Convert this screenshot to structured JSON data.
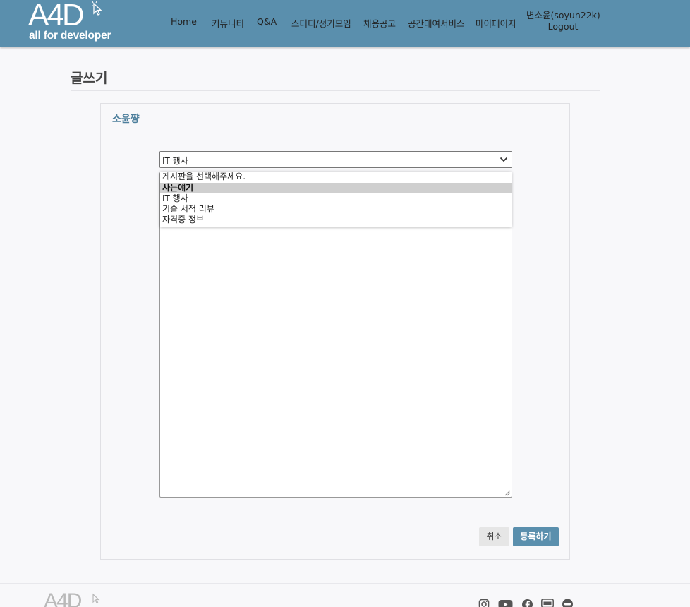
{
  "header": {
    "logo_main": "A4D",
    "logo_sub": "all for developer",
    "nav": [
      {
        "label": "Home"
      },
      {
        "label": "커뮤니티"
      },
      {
        "label": "Q&A"
      },
      {
        "label": "스터디/정기모임"
      },
      {
        "label": "채용공고"
      },
      {
        "label": "공간대여서비스"
      },
      {
        "label": "마이페이지"
      }
    ],
    "user_name": "변소윤(soyun22k)",
    "logout_label": "Logout"
  },
  "page": {
    "title": "글쓰기"
  },
  "card": {
    "title": "소윤쨩",
    "select_value": "IT 행사",
    "dropdown_options": [
      {
        "label": "게시판을 선택해주세요."
      },
      {
        "label": "사는얘기"
      },
      {
        "label": "IT 행사"
      },
      {
        "label": "기술 서적 리뷰"
      },
      {
        "label": "자격증 정보"
      }
    ],
    "highlighted_option": "사는얘기",
    "cancel_label": "취소",
    "submit_label": "등록하기"
  },
  "footer": {
    "logo": "A4D",
    "social_icons": [
      "instagram-icon",
      "youtube-icon",
      "facebook-icon",
      "blog-icon",
      "channel-icon"
    ]
  },
  "colors": {
    "brand": "#5a8fad",
    "card_title": "#4d7f9c",
    "background": "#f8f8fa"
  }
}
